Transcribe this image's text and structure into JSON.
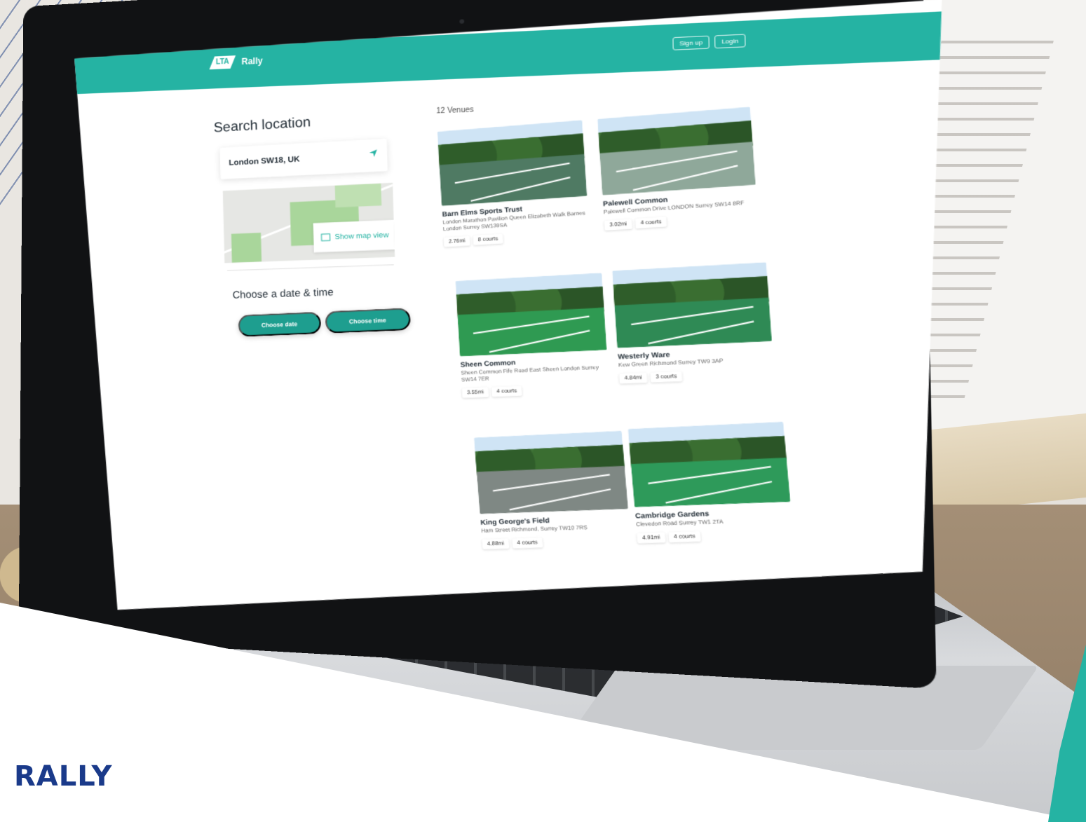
{
  "app": {
    "brand_text": "RALLY"
  },
  "nav": {
    "logo_mark": "LTA",
    "logo_text": "Rally",
    "signup_label": "Sign up",
    "login_label": "Login"
  },
  "search": {
    "title": "Search location",
    "value": "London SW18, UK",
    "map_button_label": "Show map view"
  },
  "datetime": {
    "title": "Choose a date & time",
    "date_button": "Choose date",
    "time_button": "Choose time"
  },
  "venues": {
    "count_label": "12 Venues",
    "items": [
      {
        "name": "Barn Elms Sports Trust",
        "address": "London Marathon Pavilion Queen Elizabeth Walk Barnes London Surrey SW139SA",
        "distance": "2.76mi",
        "courts": "8 courts"
      },
      {
        "name": "Palewell Common",
        "address": "Palewell Common Drive LONDON Surrey SW14 8RF",
        "distance": "3.02mi",
        "courts": "4 courts"
      },
      {
        "name": "Sheen Common",
        "address": "Sheen Common Fife Road East Sheen London Surrey SW14 7ER",
        "distance": "3.55mi",
        "courts": "4 courts"
      },
      {
        "name": "Westerly Ware",
        "address": "Kew Green Richmond Surrey TW9 3AP",
        "distance": "4.84mi",
        "courts": "3 courts"
      },
      {
        "name": "King George's Field",
        "address": "Ham Street Richmond, Surrey TW10 7RS",
        "distance": "4.88mi",
        "courts": "4 courts"
      },
      {
        "name": "Cambridge Gardens",
        "address": "Clevedon Road Surrey TW1 2TA",
        "distance": "4.91mi",
        "courts": "4 courts"
      }
    ]
  },
  "colors": {
    "accent": "#25b3a3",
    "button": "#1e9e8f",
    "brand": "#1a3a8a"
  }
}
